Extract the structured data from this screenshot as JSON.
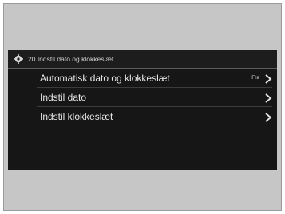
{
  "header": {
    "title": "20 Indstil dato og klokkeslæt",
    "icon": "gear-icon"
  },
  "menu": {
    "items": [
      {
        "label": "Automatisk dato og klokkeslæt",
        "status": "Fra",
        "icon": "chevron-right-icon"
      },
      {
        "label": "Indstil dato",
        "icon": "chevron-right-icon"
      },
      {
        "label": "Indstil klokkeslæt",
        "icon": "chevron-right-icon"
      }
    ]
  },
  "colors": {
    "screen_background": "#161616",
    "frame_background": "#c6c6c6",
    "text": "#e6e6e6"
  }
}
